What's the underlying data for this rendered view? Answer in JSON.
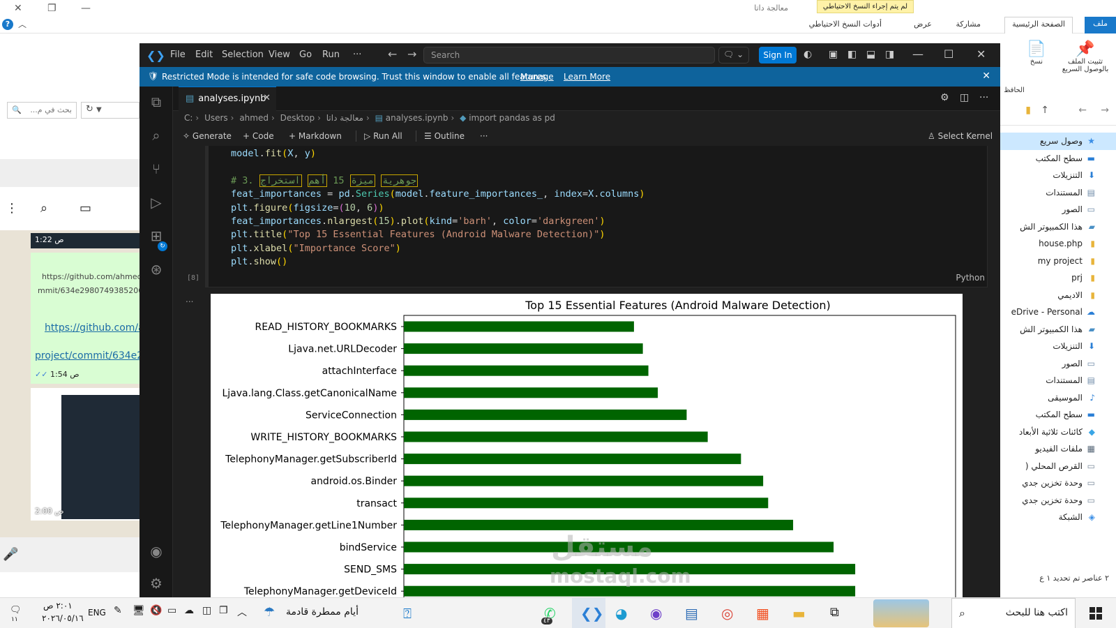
{
  "explorer": {
    "window_title": "معالجة داتا",
    "banner": "لم يتم إجراء النسخ الاحتياطي",
    "ribbon_tabs": {
      "file": "ملف",
      "home": "الصفحة الرئيسية",
      "share": "مشاركة",
      "view": "عرض",
      "backup_tools": "أدوات النسخ الاحتياطي"
    },
    "ribbon_buttons": {
      "pin": "تثبيت الملف بالوصول السريع",
      "copy": "نسخ",
      "clipboard": "الحافظ"
    },
    "tree": [
      {
        "label": "وصول سريع",
        "icon": "star-icon",
        "selected": true
      },
      {
        "label": "سطح المكتب",
        "icon": "desktop-icon"
      },
      {
        "label": "التنزيلات",
        "icon": "download-icon"
      },
      {
        "label": "المستندات",
        "icon": "document-icon"
      },
      {
        "label": "الصور",
        "icon": "picture-icon"
      },
      {
        "label": "هذا الكمبيوتر الش",
        "icon": "computer-icon"
      },
      {
        "label": "house.php",
        "icon": "folder-icon"
      },
      {
        "label": "my project",
        "icon": "folder-icon"
      },
      {
        "label": "prj",
        "icon": "folder-icon"
      },
      {
        "label": "الاديمي",
        "icon": "folder-icon"
      },
      {
        "label": "eDrive - Personal",
        "icon": "cloud-icon"
      },
      {
        "label": "هذا الكمبيوتر الش",
        "icon": "computer-icon"
      },
      {
        "label": "التنزيلات",
        "icon": "download-icon"
      },
      {
        "label": "الصور",
        "icon": "picture-icon"
      },
      {
        "label": "المستندات",
        "icon": "document-icon"
      },
      {
        "label": "الموسيقى",
        "icon": "music-icon"
      },
      {
        "label": "سطح المكتب",
        "icon": "desktop-icon"
      },
      {
        "label": "كائنات ثلاثية الأبعاد",
        "icon": "cube-icon"
      },
      {
        "label": "ملفات الفيديو",
        "icon": "video-icon"
      },
      {
        "label": "القرص المحلي (",
        "icon": "drive-icon"
      },
      {
        "label": "وحدة تخزين جدي",
        "icon": "drive-icon"
      },
      {
        "label": "وحدة تخزين جدي",
        "icon": "drive-icon"
      },
      {
        "label": "الشبكة",
        "icon": "network-icon"
      }
    ],
    "status": "٢ عناصر   تم تحديد ١ ع"
  },
  "whatsapp": {
    "search_placeholder": "بحث في م...",
    "messages": [
      {
        "time": "1:22 ص"
      },
      {
        "url_line1": "https://github.com/ahmed",
        "url_line2": "mmit/634e29807493852060",
        "link1": "https://github.com/a",
        "link2": "project/commit/634e2",
        "time": "1:54 ص"
      },
      {
        "time": "2:00 ص"
      }
    ]
  },
  "vscode": {
    "menu": [
      "File",
      "Edit",
      "Selection",
      "View",
      "Go",
      "Run",
      "···"
    ],
    "search_placeholder": "Search",
    "sign_in": "Sign In",
    "restricted": {
      "message": "Restricted Mode is intended for safe code browsing. Trust this window to enable all features.",
      "manage": "Manage",
      "learn_more": "Learn More"
    },
    "tab": {
      "name": "analyses.ipynb"
    },
    "breadcrumb": [
      "C:",
      "Users",
      "ahmed",
      "Desktop",
      "معالجة داتا",
      "analyses.ipynb",
      "import pandas as pd"
    ],
    "notebook_toolbar": {
      "generate": "Generate",
      "code": "Code",
      "markdown": "Markdown",
      "run_all": "Run All",
      "outline": "Outline",
      "more": "···",
      "kernel": "Select Kernel"
    },
    "cell": {
      "exec_count": "[8]",
      "language": "Python",
      "comment_prefix": "# 3.",
      "comment_words": [
        "جوهرية",
        "ميزة",
        "15",
        "أهم",
        "استخراج"
      ],
      "output_ellipsis": "..."
    },
    "watermark": {
      "brand_ar": "مستقل",
      "brand_en": "mostaql.com"
    }
  },
  "chart_data": {
    "type": "bar",
    "orientation": "horizontal",
    "title": "Top 15 Essential Features (Android Malware Detection)",
    "categories": [
      "READ_HISTORY_BOOKMARKS",
      "Ljava.net.URLDecoder",
      "attachInterface",
      "Ljava.lang.Class.getCanonicalName",
      "ServiceConnection",
      "WRITE_HISTORY_BOOKMARKS",
      "TelephonyManager.getSubscriberId",
      "android.os.Binder",
      "transact",
      "TelephonyManager.getLine1Number",
      "bindService",
      "SEND_SMS",
      "TelephonyManager.getDeviceId"
    ],
    "values": [
      0.0415,
      0.0431,
      0.0441,
      0.0458,
      0.051,
      0.0548,
      0.0608,
      0.0648,
      0.0657,
      0.0702,
      0.0775,
      0.0814,
      0.0814
    ],
    "xlim": [
      0,
      0.0995
    ],
    "color": "#006400",
    "xlabel": "Importance Score",
    "ylabel": ""
  },
  "taskbar": {
    "search_placeholder": "اكتب هنا للبحث",
    "weather": "أيام ممطرة قادمة",
    "language": "ENG",
    "time": "٢:٠١ ص",
    "date": "٢٠٢٦/٠٥/١٦",
    "notifications": "١١",
    "whatsapp_badge": "٤٣"
  }
}
